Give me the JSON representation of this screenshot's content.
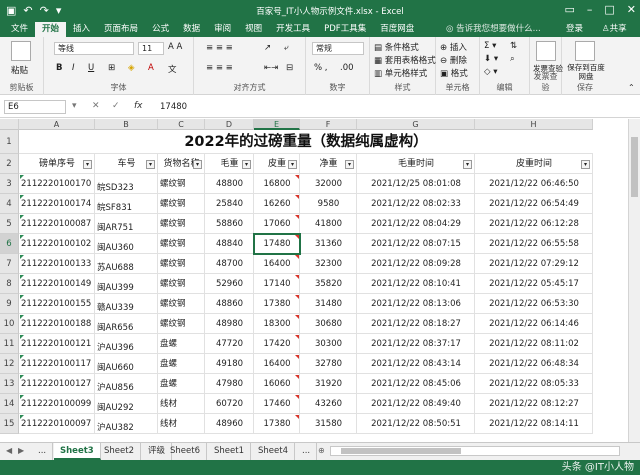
{
  "app": {
    "title": "百家号_IT小人物示例文件.xlsx - Excel"
  },
  "tabs": [
    "文件",
    "开始",
    "插入",
    "页面布局",
    "公式",
    "数据",
    "审阅",
    "视图",
    "开发工具",
    "PDF工具集",
    "百度网盘"
  ],
  "tell_me": "告诉我您想要做什么...",
  "login": "登录",
  "share": "共享",
  "ribbon": {
    "groups": [
      "剪贴板",
      "字体",
      "对齐方式",
      "数字",
      "样式",
      "单元格",
      "编辑",
      "发票查验",
      "保存"
    ],
    "font_name": "等线",
    "font_size": "11",
    "number_format": "常规",
    "paste": "粘贴",
    "cond_format": "条件格式",
    "table_format": "套用表格格式",
    "cell_style": "单元格样式",
    "insert": "插入",
    "delete": "删除",
    "format": "格式",
    "invoice": "发票查验",
    "save_baidu": "保存到百度网盘"
  },
  "formula_bar": {
    "name_box": "E6",
    "value": "17480",
    "fx": "fx"
  },
  "sheet": {
    "title": "2022年的过磅重量（数据纯属虚构）",
    "columns": [
      "A",
      "B",
      "C",
      "D",
      "E",
      "F",
      "G",
      "H"
    ],
    "headers": [
      "磅单序号",
      "车号",
      "货物名称",
      "毛重",
      "皮重",
      "净重",
      "毛重时间",
      "皮重时间"
    ],
    "rows": [
      [
        "2112220100170",
        "皖SD323",
        "螺纹钢",
        "48800",
        "16800",
        "32000",
        "2021/12/25 08:01:08",
        "2021/12/22 06:46:50"
      ],
      [
        "2112220100174",
        "皖SF831",
        "螺纹钢",
        "25840",
        "16260",
        "9580",
        "2021/12/22 08:02:33",
        "2021/12/22 06:54:49"
      ],
      [
        "2112220100087",
        "闽AR751",
        "螺纹钢",
        "58860",
        "17060",
        "41800",
        "2021/12/22 08:04:29",
        "2021/12/22 06:12:28"
      ],
      [
        "2112220100102",
        "闽AU360",
        "螺纹钢",
        "48840",
        "17480",
        "31360",
        "2021/12/22 08:07:15",
        "2021/12/22 06:55:58"
      ],
      [
        "2112220100133",
        "苏AU688",
        "螺纹钢",
        "48700",
        "16400",
        "32300",
        "2021/12/22 08:09:28",
        "2021/12/22 07:29:12"
      ],
      [
        "2112220100149",
        "闽AU399",
        "螺纹钢",
        "52960",
        "17140",
        "35820",
        "2021/12/22 08:10:41",
        "2021/12/22 05:45:17"
      ],
      [
        "2112220100155",
        "赣AU339",
        "螺纹钢",
        "48860",
        "17380",
        "31480",
        "2021/12/22 08:13:06",
        "2021/12/22 06:53:30"
      ],
      [
        "2112220100188",
        "闽AR656",
        "螺纹钢",
        "48980",
        "18300",
        "30680",
        "2021/12/22 08:18:27",
        "2021/12/22 06:14:46"
      ],
      [
        "2112220100121",
        "沪AU396",
        "盘螺",
        "47720",
        "17420",
        "30300",
        "2021/12/22 08:37:17",
        "2021/12/22 08:11:02"
      ],
      [
        "2112220100117",
        "闽AU660",
        "盘螺",
        "49180",
        "16400",
        "32780",
        "2021/12/22 08:43:14",
        "2021/12/22 06:48:34"
      ],
      [
        "2112220100127",
        "沪AU856",
        "盘螺",
        "47980",
        "16060",
        "31920",
        "2021/12/22 08:45:06",
        "2021/12/22 08:05:33"
      ],
      [
        "2112220100099",
        "闽AU292",
        "线材",
        "60720",
        "17460",
        "43260",
        "2021/12/22 08:49:40",
        "2021/12/22 08:12:27"
      ],
      [
        "2112220100097",
        "沪AU382",
        "线材",
        "48960",
        "17380",
        "31580",
        "2021/12/22 08:50:51",
        "2021/12/22 08:14:11"
      ]
    ]
  },
  "row_numbers": [
    "1",
    "2",
    "3",
    "4",
    "5",
    "6",
    "7",
    "8",
    "9",
    "10",
    "11",
    "12",
    "13",
    "14",
    "15"
  ],
  "sheet_tabs": [
    "...",
    "Sheet3",
    "Sheet2",
    "评级",
    "Sheet6",
    "Sheet1",
    "Sheet4",
    "..."
  ],
  "active_sheet": "Sheet3",
  "watermark": "头条 @IT小人物",
  "colors": {
    "excel_green": "#217346",
    "selection": "#217346"
  }
}
